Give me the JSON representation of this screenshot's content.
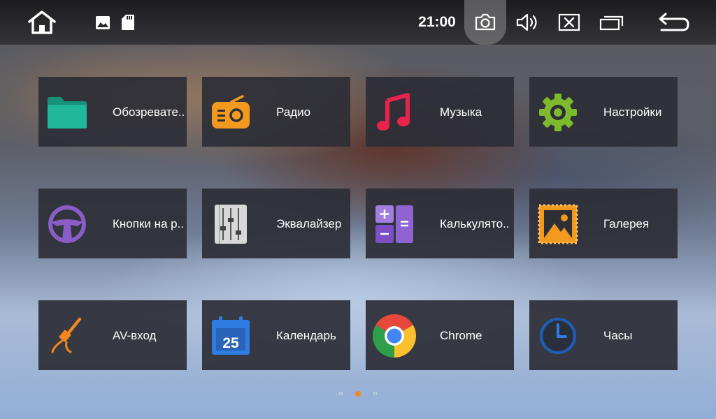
{
  "status_bar": {
    "time": "21:00",
    "icons": [
      "home-icon",
      "image-notification-icon",
      "sd-card-icon",
      "camera-icon",
      "volume-icon",
      "close-app-icon",
      "recent-apps-icon",
      "back-icon"
    ]
  },
  "apps": [
    {
      "label": "Обозревате..",
      "icon": "folder-icon",
      "color": "#1fb89a"
    },
    {
      "label": "Радио",
      "icon": "radio-icon",
      "color": "#f39a1e"
    },
    {
      "label": "Музыка",
      "icon": "music-note-icon",
      "color": "#e8234d"
    },
    {
      "label": "Настройки",
      "icon": "gear-icon",
      "color": "#7dba2c"
    },
    {
      "label": "Кнопки на р..",
      "icon": "steering-wheel-icon",
      "color": "#8a5cc6"
    },
    {
      "label": "Эквалайзер",
      "icon": "equalizer-icon",
      "color": "#d8d8d8"
    },
    {
      "label": "Калькулято..",
      "icon": "calculator-icon",
      "color": "#8f63d2"
    },
    {
      "label": "Галерея",
      "icon": "gallery-icon",
      "color": "#f39a1e"
    },
    {
      "label": "AV-вход",
      "icon": "av-cable-icon",
      "color": "#f3861e"
    },
    {
      "label": "Календарь",
      "icon": "calendar-icon",
      "color": "#2f7de0"
    },
    {
      "label": "Chrome",
      "icon": "chrome-icon",
      "color": "#4285f4"
    },
    {
      "label": "Часы",
      "icon": "clock-icon",
      "color": "#2f7de0"
    }
  ],
  "calendar_day": "25",
  "pager": {
    "pages": 3,
    "current": 2,
    "accent": "#f08a1c"
  }
}
